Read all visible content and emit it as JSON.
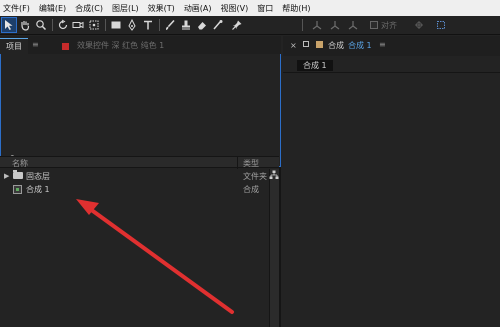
{
  "menubar": {
    "items": [
      "文件(F)",
      "编辑(E)",
      "合成(C)",
      "图层(L)",
      "效果(T)",
      "动画(A)",
      "视图(V)",
      "窗口",
      "帮助(H)"
    ]
  },
  "toolbar": {
    "align_label": "对齐",
    "tools": [
      "selection-icon",
      "hand-icon",
      "zoom-icon",
      "rotate-icon",
      "camera-icon",
      "pan-behind-icon",
      "rectangle-icon",
      "pen-icon",
      "text-icon",
      "brush-icon",
      "clone-stamp-icon",
      "eraser-icon",
      "roto-brush-icon",
      "puppet-pin-icon"
    ]
  },
  "project_panel": {
    "tab_label": "项目",
    "tab_menu": "≡",
    "effects_tab_label": "效果控件 深 红色 纯色 1",
    "search_icon_glyph": "⚲",
    "columns": {
      "name": "名称",
      "type": "类型"
    },
    "rows": [
      {
        "name": "固态层",
        "type": "文件夹",
        "kind": "folder",
        "expandable": true
      },
      {
        "name": "合成 1",
        "type": "合成",
        "kind": "composition",
        "expandable": false
      }
    ]
  },
  "composition_panel": {
    "close_glyph": "×",
    "label": "合成",
    "link_label": "合成 1",
    "menu_glyph": "≡",
    "tab_label": "合成 1"
  },
  "colors": {
    "accent": "#2c6ec8",
    "annotation_arrow": "#e03030"
  }
}
